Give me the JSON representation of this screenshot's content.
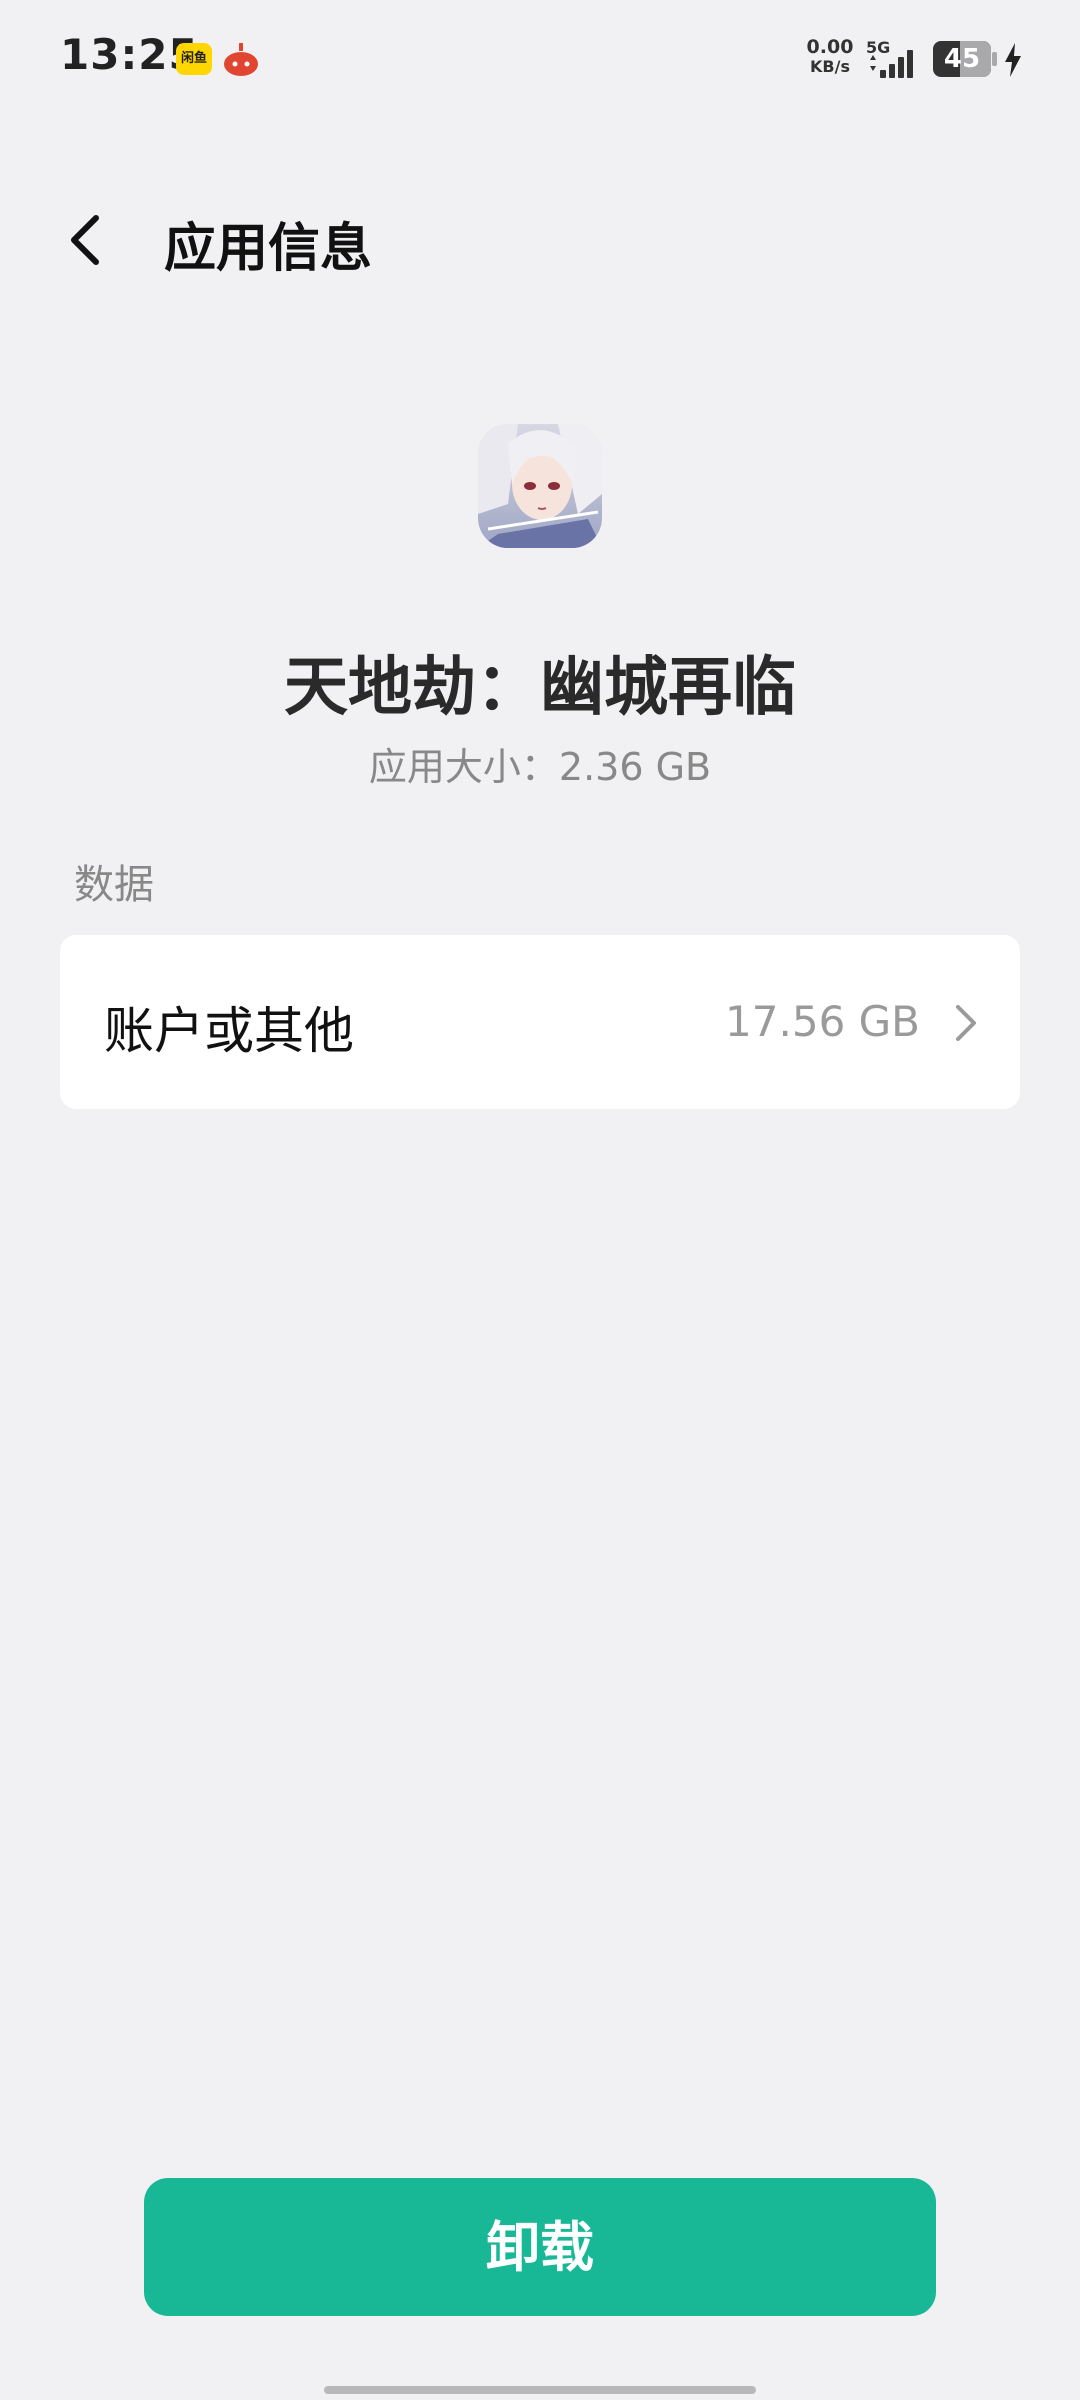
{
  "status_bar": {
    "time": "13:25",
    "notif_1_label": "闲鱼",
    "net_speed_value": "0.00",
    "net_speed_unit": "KB/s",
    "network_type": "5G",
    "battery_level": "45"
  },
  "header": {
    "title": "应用信息"
  },
  "app": {
    "name": "天地劫：幽城再临",
    "size_text": "应用大小：2.36 GB"
  },
  "section": {
    "data_label": "数据"
  },
  "data_rows": [
    {
      "label": "账户或其他",
      "value": "17.56 GB"
    }
  ],
  "actions": {
    "uninstall_label": "卸载"
  },
  "colors": {
    "accent": "#18b897",
    "background": "#f1f1f3"
  }
}
